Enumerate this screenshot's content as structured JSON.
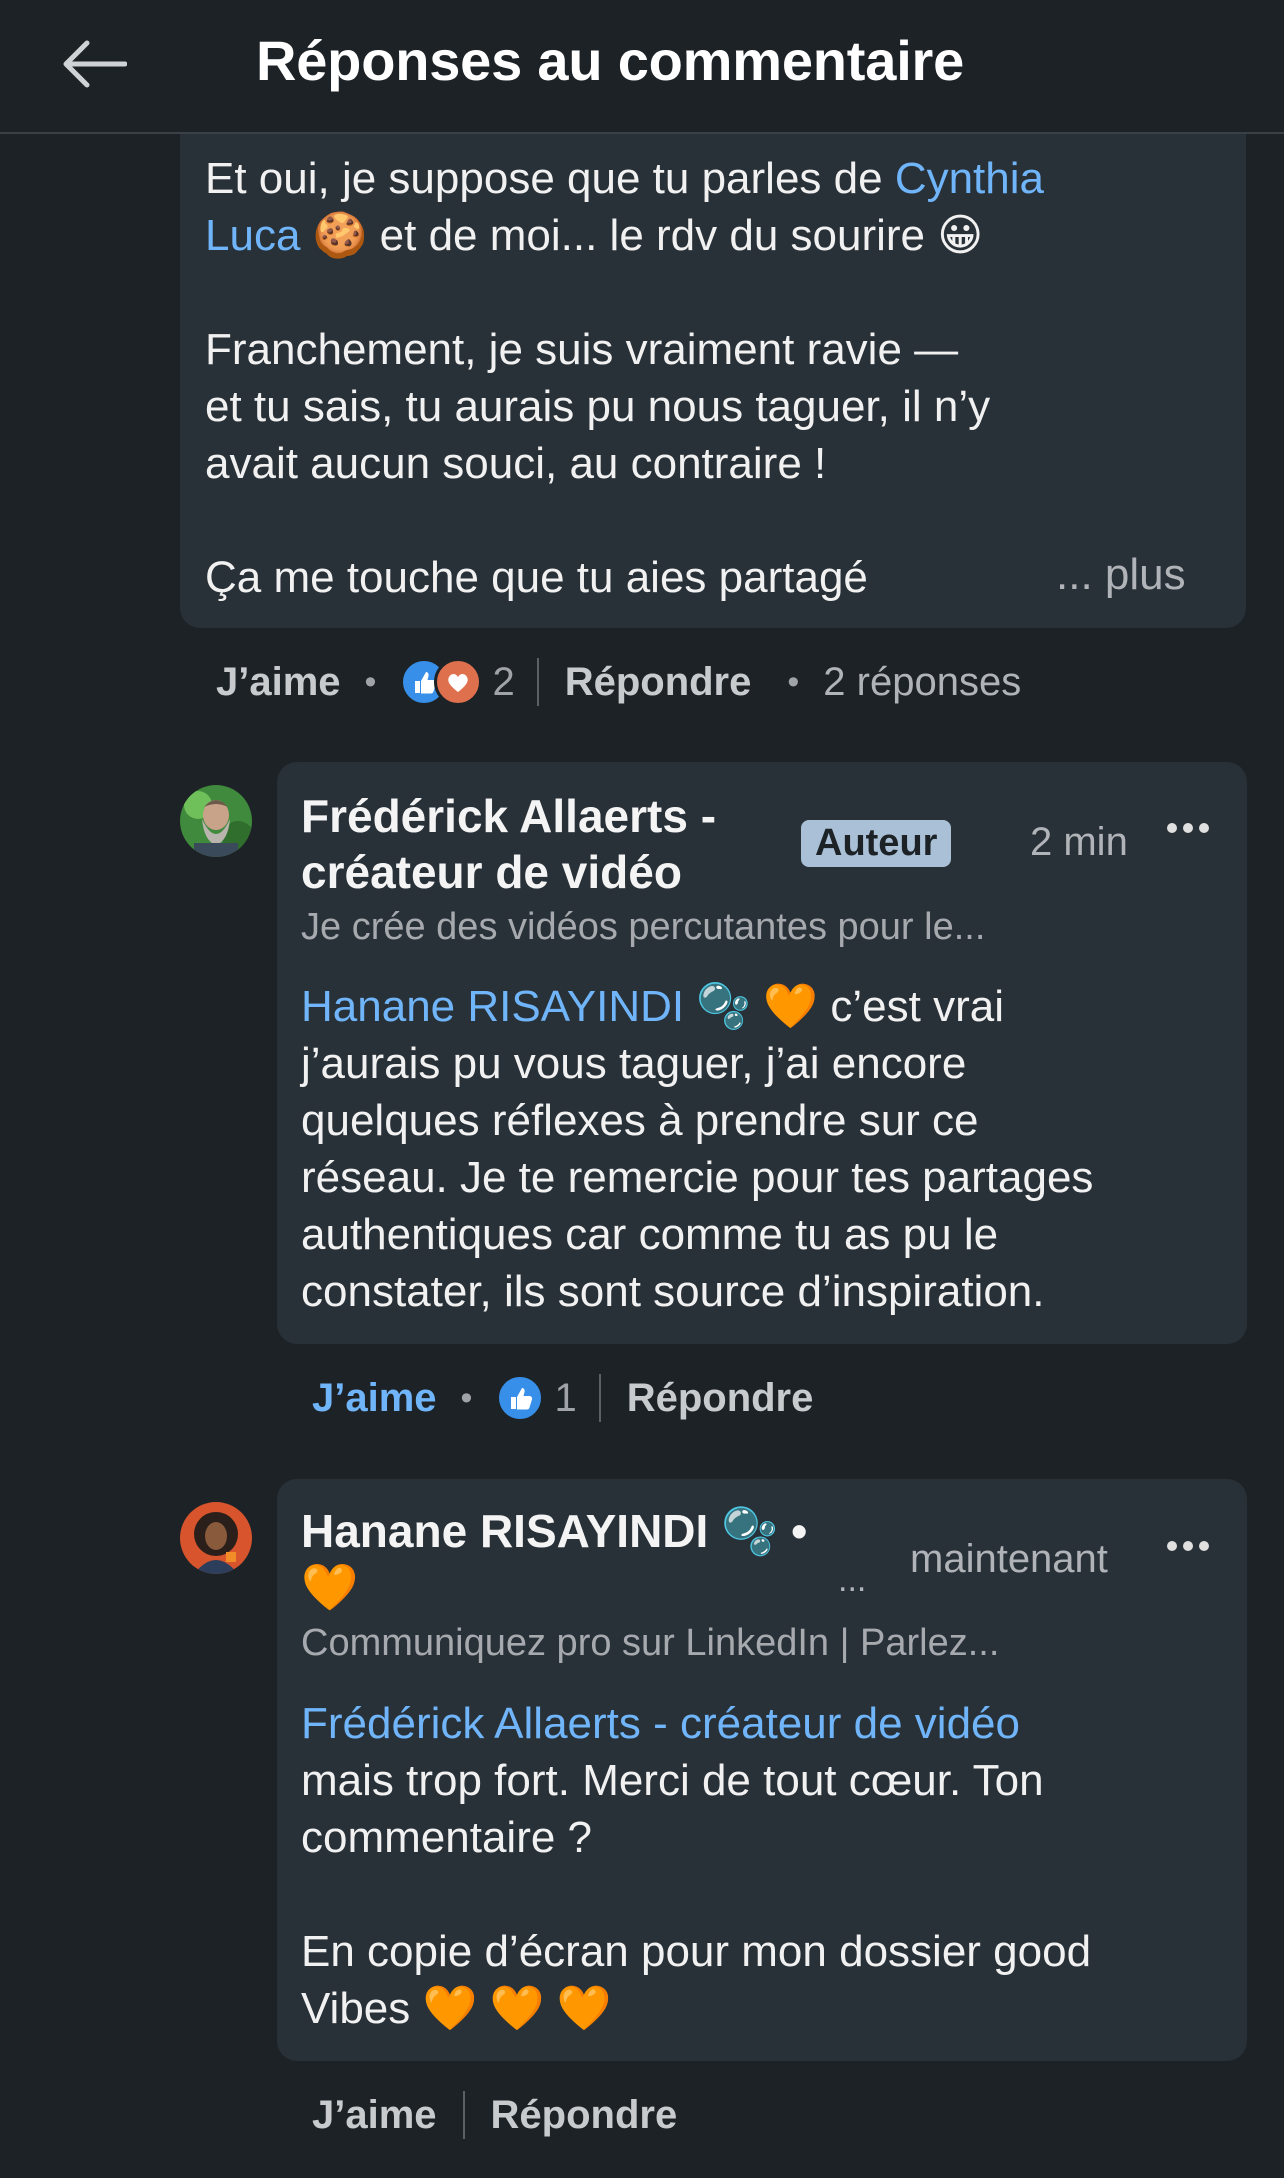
{
  "header": {
    "title": "Réponses au commentaire"
  },
  "parent_comment": {
    "lines": [
      {
        "parts": [
          {
            "text": "Et oui, je suppose que tu parles de "
          },
          {
            "text": "Cynthia",
            "mention": true
          }
        ]
      },
      {
        "parts": [
          {
            "text": "Luca",
            "mention": true
          },
          {
            "text": " 🍪  et de moi... le rdv du sourire 😀"
          }
        ]
      },
      {
        "blank": true
      },
      {
        "parts": [
          {
            "text": "Franchement, je suis vraiment ravie —"
          }
        ]
      },
      {
        "parts": [
          {
            "text": "et tu sais, tu aurais pu nous taguer, il n’y"
          }
        ]
      },
      {
        "parts": [
          {
            "text": "avait aucun souci, au contraire !"
          }
        ]
      },
      {
        "blank": true
      },
      {
        "parts": [
          {
            "text": "Ça me touche que tu aies partagé"
          }
        ]
      }
    ],
    "more_label": "... plus",
    "actions": {
      "like_label": "J’aime",
      "reaction_count": "2",
      "reply_label": "Répondre",
      "replies_count_label": "2 réponses"
    }
  },
  "replies": [
    {
      "author_line1": "Frédérick Allaerts -",
      "author_line2": "créateur de vidéo",
      "badge": "Auteur",
      "time": "2 min",
      "more": "•••",
      "headline": "Je crée des vidéos percutantes pour le...",
      "lines": [
        {
          "parts": [
            {
              "text": "Hanane RISAYINDI",
              "mention": true
            },
            {
              "text": " 🫧 🧡  c’est vrai"
            }
          ]
        },
        {
          "parts": [
            {
              "text": "j’aurais pu vous taguer, j’ai encore"
            }
          ]
        },
        {
          "parts": [
            {
              "text": "quelques réflexes à prendre sur ce"
            }
          ]
        },
        {
          "parts": [
            {
              "text": "réseau. Je te remercie pour tes partages"
            }
          ]
        },
        {
          "parts": [
            {
              "text": "authentiques car comme tu as pu le"
            }
          ]
        },
        {
          "parts": [
            {
              "text": "constater, ils sont source d’inspiration."
            }
          ]
        }
      ],
      "actions": {
        "like_label": "J’aime",
        "reaction_count": "1",
        "reply_label": "Répondre"
      }
    },
    {
      "author_line1": "Hanane RISAYINDI 🫧 •",
      "author_line2": "🧡",
      "connection": "...",
      "time": "maintenant",
      "more": "•••",
      "headline": "Communiquez pro sur LinkedIn | Parlez...",
      "lines": [
        {
          "parts": [
            {
              "text": "Frédérick Allaerts - créateur de vidéo",
              "mention": true
            }
          ]
        },
        {
          "parts": [
            {
              "text": "mais trop fort. Merci de tout cœur. Ton"
            }
          ]
        },
        {
          "parts": [
            {
              "text": "commentaire ?"
            }
          ]
        },
        {
          "blank": true
        },
        {
          "parts": [
            {
              "text": "En copie d’écran pour mon dossier good"
            }
          ]
        },
        {
          "parts": [
            {
              "text": "Vibes 🧡 🧡 🧡"
            }
          ]
        }
      ],
      "actions": {
        "like_label": "J’aime",
        "reply_label": "Répondre"
      }
    }
  ],
  "colors": {
    "background": "#1d2226",
    "bubble": "#293138",
    "mention": "#70b5f9",
    "badge": "#a9c0d6"
  }
}
